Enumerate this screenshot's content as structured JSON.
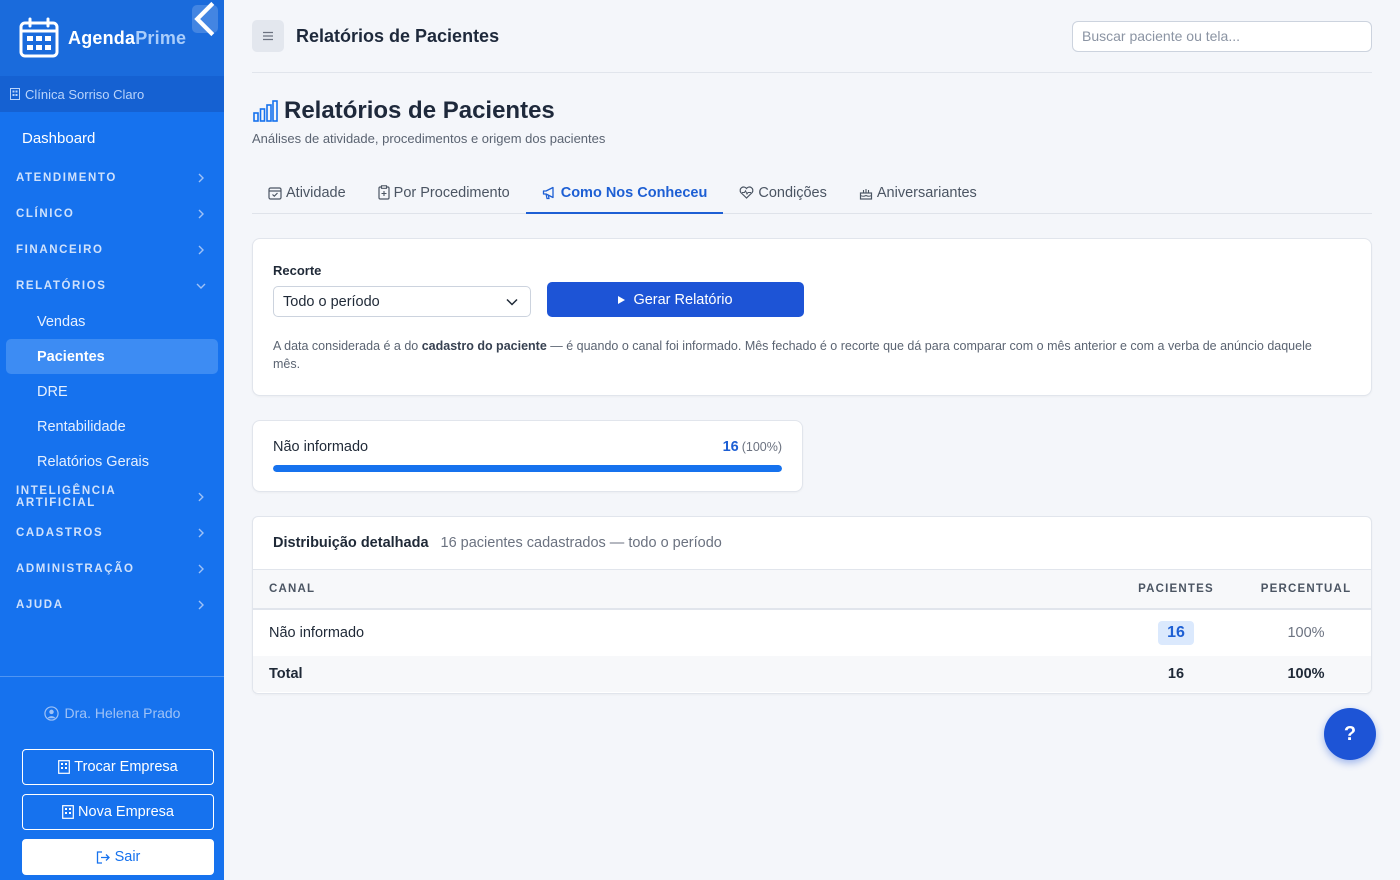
{
  "brand": {
    "part1": "Agenda",
    "part2": "Prime"
  },
  "clinic": "Clínica Sorriso Claro",
  "nav": {
    "dashboard": "Dashboard",
    "sections": {
      "atendimento": "ATENDIMENTO",
      "clinico": "CLÍNICO",
      "financeiro": "FINANCEIRO",
      "relatorios": "RELATÓRIOS",
      "ia": "INTELIGÊNCIA ARTIFICIAL",
      "cadastros": "CADASTROS",
      "administracao": "ADMINISTRAÇÃO",
      "ajuda": "AJUDA"
    },
    "relatorios_items": [
      "Vendas",
      "Pacientes",
      "DRE",
      "Rentabilidade",
      "Relatórios Gerais"
    ]
  },
  "user": {
    "name": "Dra. Helena Prado"
  },
  "sidebar_buttons": {
    "switch": "Trocar Empresa",
    "new": "Nova Empresa",
    "logout": "Sair"
  },
  "topbar": {
    "title": "Relatórios de Pacientes",
    "search_placeholder": "Buscar paciente ou tela..."
  },
  "page": {
    "title": "Relatórios de Pacientes",
    "subtitle": "Análises de atividade, procedimentos e origem dos pacientes"
  },
  "tabs": [
    "Atividade",
    "Por Procedimento",
    "Como Nos Conheceu",
    "Condições",
    "Aniversariantes"
  ],
  "filter": {
    "label": "Recorte",
    "selected": "Todo o período",
    "button": "Gerar Relatório",
    "note_pre": "A data considerada é a do ",
    "note_bold": "cadastro do paciente",
    "note_post": " — é quando o canal foi informado. Mês fechado é o recorte que dá para comparar com o mês anterior e com a verba de anúncio daquele mês."
  },
  "channel_summary": {
    "name": "Não informado",
    "count": "16",
    "pct": "(100%)",
    "fill_fraction": 1.0
  },
  "distribution": {
    "title": "Distribuição detalhada",
    "subtitle": "16 pacientes cadastrados — todo o período",
    "headers": {
      "canal": "CANAL",
      "pacientes": "PACIENTES",
      "percentual": "PERCENTUAL"
    },
    "rows": [
      {
        "canal": "Não informado",
        "pacientes": "16",
        "percentual": "100%"
      }
    ],
    "total": {
      "label": "Total",
      "pacientes": "16",
      "percentual": "100%"
    }
  },
  "help": "?",
  "colors": {
    "sidebar": "#1672ee",
    "accent": "#1d54d6",
    "active_tab": "#1d5fd4"
  }
}
